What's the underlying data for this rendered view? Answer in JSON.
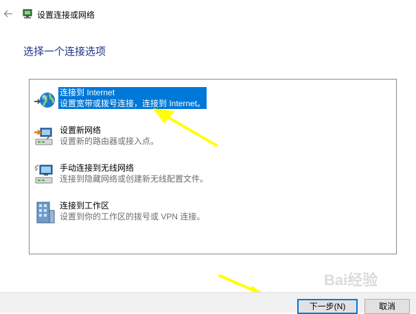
{
  "window": {
    "title": "设置连接或网络"
  },
  "heading": "选择一个连接选项",
  "options": [
    {
      "title": "连接到 Internet",
      "description": "设置宽带或拨号连接，连接到 Internet。",
      "icon": "globe-icon",
      "selected": true
    },
    {
      "title": "设置新网络",
      "description": "设置新的路由器或接入点。",
      "icon": "new-network-icon",
      "selected": false
    },
    {
      "title": "手动连接到无线网络",
      "description": "连接到隐藏网络或创建新无线配置文件。",
      "icon": "wireless-network-icon",
      "selected": false
    },
    {
      "title": "连接到工作区",
      "description": "设置到你的工作区的拨号或 VPN 连接。",
      "icon": "workplace-icon",
      "selected": false
    }
  ],
  "buttons": {
    "next": "下一步(N)",
    "cancel": "取消"
  },
  "colors": {
    "selection": "#0078d7",
    "heading": "#1e3287",
    "annotation_arrow": "#ffff00"
  },
  "watermark": "Bai经验"
}
